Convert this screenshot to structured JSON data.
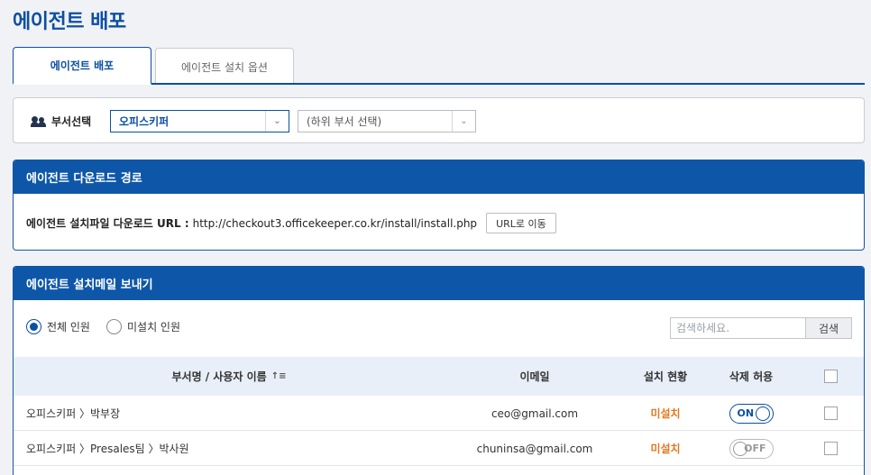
{
  "page": {
    "title": "에이전트 배포"
  },
  "tabs": [
    {
      "label": "에이전트 배포"
    },
    {
      "label": "에이전트 설치 옵션"
    }
  ],
  "department": {
    "label": "부서선택",
    "selected": "오피스키퍼",
    "sub_placeholder": "(하위 부서 선택)"
  },
  "download": {
    "header": "에이전트 다운로드 경로",
    "label": "에이전트 설치파일 다운로드 URL :",
    "url": "http://checkout3.officekeeper.co.kr/install/install.php",
    "go_button": "URL로 이동"
  },
  "mail": {
    "header": "에이전트 설치메일 보내기",
    "radios": [
      {
        "label": "전체 인원",
        "checked": true
      },
      {
        "label": "미설치 인원",
        "checked": false
      }
    ],
    "search_placeholder": "검색하세요.",
    "search_button": "검색",
    "columns": {
      "name": "부서명 / 사용자 이름",
      "sort_icon": "↑≡",
      "email": "이메일",
      "status": "설치 현황",
      "delete": "삭제 허용"
    },
    "rows": [
      {
        "name": "오피스키퍼 〉박부장",
        "email": "ceo@gmail.com",
        "status": "미설치",
        "toggle": "ON"
      },
      {
        "name": "오피스키퍼 〉Presales팀 〉박사원",
        "email": "chuninsa@gmail.com",
        "status": "미설치",
        "toggle": "OFF"
      }
    ]
  },
  "colors": {
    "primary": "#0d4fa3",
    "header_bg": "#0e57a8",
    "status_orange": "#e07a1f"
  }
}
